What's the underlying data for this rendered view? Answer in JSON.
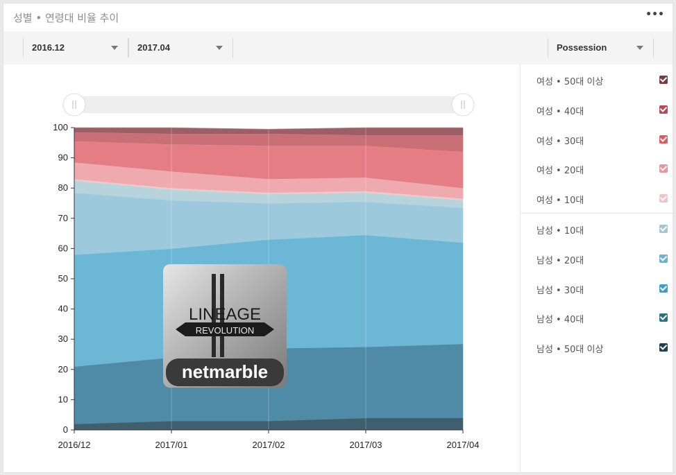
{
  "header": {
    "title": "성별 • 연령대 비율 추이",
    "more_label": "•••"
  },
  "toolbar": {
    "from_date": "2016.12",
    "to_date": "2017.04",
    "metric": "Possession"
  },
  "legend": {
    "items": [
      {
        "label": "여성 • 50대 이상",
        "color": "#7a3a3e"
      },
      {
        "label": "여성 • 40대",
        "color": "#b84a50"
      },
      {
        "label": "여성 • 30대",
        "color": "#dd5a63"
      },
      {
        "label": "여성 • 20대",
        "color": "#eb949a"
      },
      {
        "label": "여성 • 10대",
        "color": "#f2c2c5"
      },
      {
        "label": "남성 • 10대",
        "color": "#a7c4d2"
      },
      {
        "label": "남성 • 20대",
        "color": "#6eb2d2"
      },
      {
        "label": "남성 • 30대",
        "color": "#3aa0c6"
      },
      {
        "label": "남성 • 40대",
        "color": "#2f6f86"
      },
      {
        "label": "남성 • 50대 이상",
        "color": "#1e3f55"
      }
    ]
  },
  "overlay": {
    "logo_text": "LINEAGE",
    "logo_sub": "REVOLUTION",
    "logo_brand": "netmarble"
  },
  "chart_data": {
    "type": "area",
    "stacked": true,
    "categories": [
      "2016/12",
      "2017/01",
      "2017/02",
      "2017/03",
      "2017/04"
    ],
    "ylim": [
      0,
      100
    ],
    "yticks": [
      0,
      10,
      20,
      30,
      40,
      50,
      60,
      70,
      80,
      90,
      100
    ],
    "grid": true,
    "series": [
      {
        "name": "남성 • 50대 이상",
        "color": "#3f5f6f",
        "values": [
          2,
          3,
          3,
          4,
          4
        ]
      },
      {
        "name": "남성 • 40대",
        "color": "#4f8aa6",
        "values": [
          19,
          21,
          24,
          23.5,
          24.5
        ]
      },
      {
        "name": "남성 • 30대",
        "color": "#6db7d6",
        "values": [
          37,
          36,
          36,
          37,
          33.5
        ]
      },
      {
        "name": "남성 • 20대",
        "color": "#9dc9dc",
        "values": [
          20.5,
          16,
          12,
          11,
          11.5
        ]
      },
      {
        "name": "남성 • 10대",
        "color": "#b7d3dc",
        "values": [
          4,
          3.5,
          3,
          3,
          2.5
        ]
      },
      {
        "name": "여성 • 10대",
        "color": "#f0c8cb",
        "values": [
          0.5,
          0.5,
          0.5,
          0.5,
          0.5
        ]
      },
      {
        "name": "여성 • 20대",
        "color": "#eeaaae",
        "values": [
          5.5,
          5.5,
          4.5,
          4.5,
          3.5
        ]
      },
      {
        "name": "여성 • 30대",
        "color": "#e57e84",
        "values": [
          7,
          9,
          11,
          10.5,
          12
        ]
      },
      {
        "name": "여성 • 40대",
        "color": "#c87075",
        "values": [
          3,
          3.5,
          4,
          3.5,
          5.5
        ]
      },
      {
        "name": "여성 • 50대 이상",
        "color": "#9c5f66",
        "values": [
          1.5,
          2,
          1.5,
          2.5,
          2.5
        ]
      }
    ]
  }
}
